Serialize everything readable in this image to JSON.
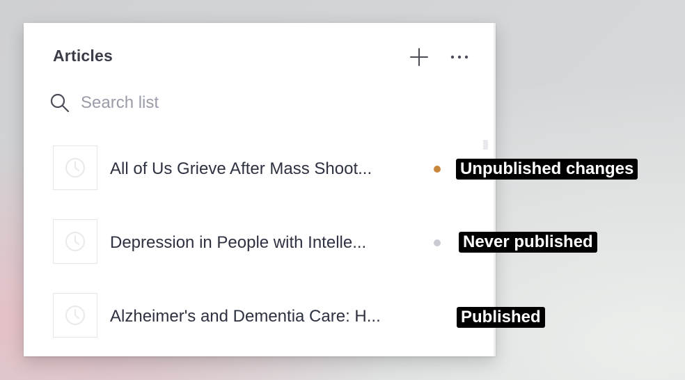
{
  "panel": {
    "title": "Articles",
    "add_icon": "plus-icon",
    "more_icon": "ellipsis-icon"
  },
  "search": {
    "placeholder": "Search list",
    "icon": "search-icon"
  },
  "items": [
    {
      "title": "All of Us Grieve After Mass Shoot...",
      "status": "Unpublished changes",
      "status_color": "#c8873a",
      "icon": "clock-icon"
    },
    {
      "title": "Depression in People with Intelle...",
      "status": "Never published",
      "status_color": "#c9cbd2",
      "icon": "clock-icon"
    },
    {
      "title": "Alzheimer's and Dementia Care: H...",
      "status": "Published",
      "status_color": null,
      "icon": "clock-icon"
    }
  ],
  "colors": {
    "tooltip_bg": "#000000",
    "tooltip_text": "#ffffff",
    "title_text": "#3a3d47"
  }
}
